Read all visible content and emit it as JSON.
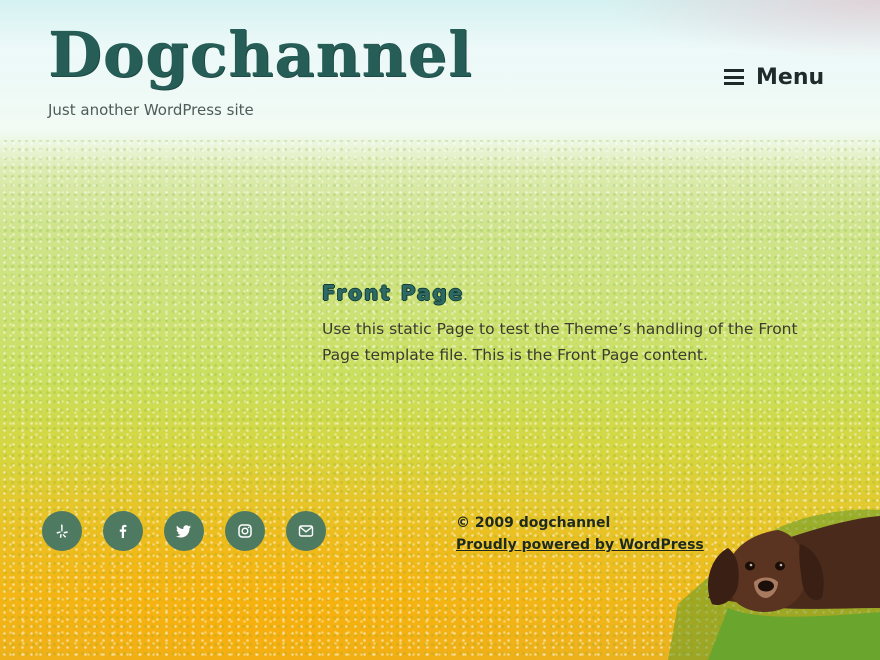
{
  "site": {
    "title": "Dogchannel",
    "tagline": "Just another WordPress site"
  },
  "nav": {
    "menu_label": "Menu"
  },
  "page": {
    "title": "Front Page",
    "content": "Use this static Page to test the Theme’s handling of the Front Page template file. This is the Front Page content."
  },
  "social_links": [
    {
      "icon": "yelp-icon"
    },
    {
      "icon": "facebook-icon"
    },
    {
      "icon": "twitter-icon"
    },
    {
      "icon": "instagram-icon"
    },
    {
      "icon": "email-icon"
    }
  ],
  "footer": {
    "copyright": "© 2009 dogchannel",
    "powered_by": "Proudly powered by WordPress"
  },
  "colors": {
    "title": "#265e57",
    "social_bg": "#4f7a62",
    "text": "#1f2a2a"
  }
}
